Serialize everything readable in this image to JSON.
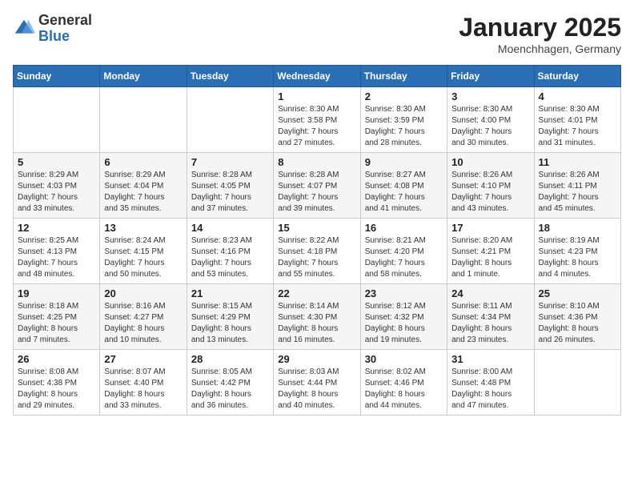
{
  "header": {
    "logo_general": "General",
    "logo_blue": "Blue",
    "month_year": "January 2025",
    "location": "Moenchhagen, Germany"
  },
  "weekdays": [
    "Sunday",
    "Monday",
    "Tuesday",
    "Wednesday",
    "Thursday",
    "Friday",
    "Saturday"
  ],
  "weeks": [
    [
      {
        "day": "",
        "info": ""
      },
      {
        "day": "",
        "info": ""
      },
      {
        "day": "",
        "info": ""
      },
      {
        "day": "1",
        "info": "Sunrise: 8:30 AM\nSunset: 3:58 PM\nDaylight: 7 hours\nand 27 minutes."
      },
      {
        "day": "2",
        "info": "Sunrise: 8:30 AM\nSunset: 3:59 PM\nDaylight: 7 hours\nand 28 minutes."
      },
      {
        "day": "3",
        "info": "Sunrise: 8:30 AM\nSunset: 4:00 PM\nDaylight: 7 hours\nand 30 minutes."
      },
      {
        "day": "4",
        "info": "Sunrise: 8:30 AM\nSunset: 4:01 PM\nDaylight: 7 hours\nand 31 minutes."
      }
    ],
    [
      {
        "day": "5",
        "info": "Sunrise: 8:29 AM\nSunset: 4:03 PM\nDaylight: 7 hours\nand 33 minutes."
      },
      {
        "day": "6",
        "info": "Sunrise: 8:29 AM\nSunset: 4:04 PM\nDaylight: 7 hours\nand 35 minutes."
      },
      {
        "day": "7",
        "info": "Sunrise: 8:28 AM\nSunset: 4:05 PM\nDaylight: 7 hours\nand 37 minutes."
      },
      {
        "day": "8",
        "info": "Sunrise: 8:28 AM\nSunset: 4:07 PM\nDaylight: 7 hours\nand 39 minutes."
      },
      {
        "day": "9",
        "info": "Sunrise: 8:27 AM\nSunset: 4:08 PM\nDaylight: 7 hours\nand 41 minutes."
      },
      {
        "day": "10",
        "info": "Sunrise: 8:26 AM\nSunset: 4:10 PM\nDaylight: 7 hours\nand 43 minutes."
      },
      {
        "day": "11",
        "info": "Sunrise: 8:26 AM\nSunset: 4:11 PM\nDaylight: 7 hours\nand 45 minutes."
      }
    ],
    [
      {
        "day": "12",
        "info": "Sunrise: 8:25 AM\nSunset: 4:13 PM\nDaylight: 7 hours\nand 48 minutes."
      },
      {
        "day": "13",
        "info": "Sunrise: 8:24 AM\nSunset: 4:15 PM\nDaylight: 7 hours\nand 50 minutes."
      },
      {
        "day": "14",
        "info": "Sunrise: 8:23 AM\nSunset: 4:16 PM\nDaylight: 7 hours\nand 53 minutes."
      },
      {
        "day": "15",
        "info": "Sunrise: 8:22 AM\nSunset: 4:18 PM\nDaylight: 7 hours\nand 55 minutes."
      },
      {
        "day": "16",
        "info": "Sunrise: 8:21 AM\nSunset: 4:20 PM\nDaylight: 7 hours\nand 58 minutes."
      },
      {
        "day": "17",
        "info": "Sunrise: 8:20 AM\nSunset: 4:21 PM\nDaylight: 8 hours\nand 1 minute."
      },
      {
        "day": "18",
        "info": "Sunrise: 8:19 AM\nSunset: 4:23 PM\nDaylight: 8 hours\nand 4 minutes."
      }
    ],
    [
      {
        "day": "19",
        "info": "Sunrise: 8:18 AM\nSunset: 4:25 PM\nDaylight: 8 hours\nand 7 minutes."
      },
      {
        "day": "20",
        "info": "Sunrise: 8:16 AM\nSunset: 4:27 PM\nDaylight: 8 hours\nand 10 minutes."
      },
      {
        "day": "21",
        "info": "Sunrise: 8:15 AM\nSunset: 4:29 PM\nDaylight: 8 hours\nand 13 minutes."
      },
      {
        "day": "22",
        "info": "Sunrise: 8:14 AM\nSunset: 4:30 PM\nDaylight: 8 hours\nand 16 minutes."
      },
      {
        "day": "23",
        "info": "Sunrise: 8:12 AM\nSunset: 4:32 PM\nDaylight: 8 hours\nand 19 minutes."
      },
      {
        "day": "24",
        "info": "Sunrise: 8:11 AM\nSunset: 4:34 PM\nDaylight: 8 hours\nand 23 minutes."
      },
      {
        "day": "25",
        "info": "Sunrise: 8:10 AM\nSunset: 4:36 PM\nDaylight: 8 hours\nand 26 minutes."
      }
    ],
    [
      {
        "day": "26",
        "info": "Sunrise: 8:08 AM\nSunset: 4:38 PM\nDaylight: 8 hours\nand 29 minutes."
      },
      {
        "day": "27",
        "info": "Sunrise: 8:07 AM\nSunset: 4:40 PM\nDaylight: 8 hours\nand 33 minutes."
      },
      {
        "day": "28",
        "info": "Sunrise: 8:05 AM\nSunset: 4:42 PM\nDaylight: 8 hours\nand 36 minutes."
      },
      {
        "day": "29",
        "info": "Sunrise: 8:03 AM\nSunset: 4:44 PM\nDaylight: 8 hours\nand 40 minutes."
      },
      {
        "day": "30",
        "info": "Sunrise: 8:02 AM\nSunset: 4:46 PM\nDaylight: 8 hours\nand 44 minutes."
      },
      {
        "day": "31",
        "info": "Sunrise: 8:00 AM\nSunset: 4:48 PM\nDaylight: 8 hours\nand 47 minutes."
      },
      {
        "day": "",
        "info": ""
      }
    ]
  ]
}
